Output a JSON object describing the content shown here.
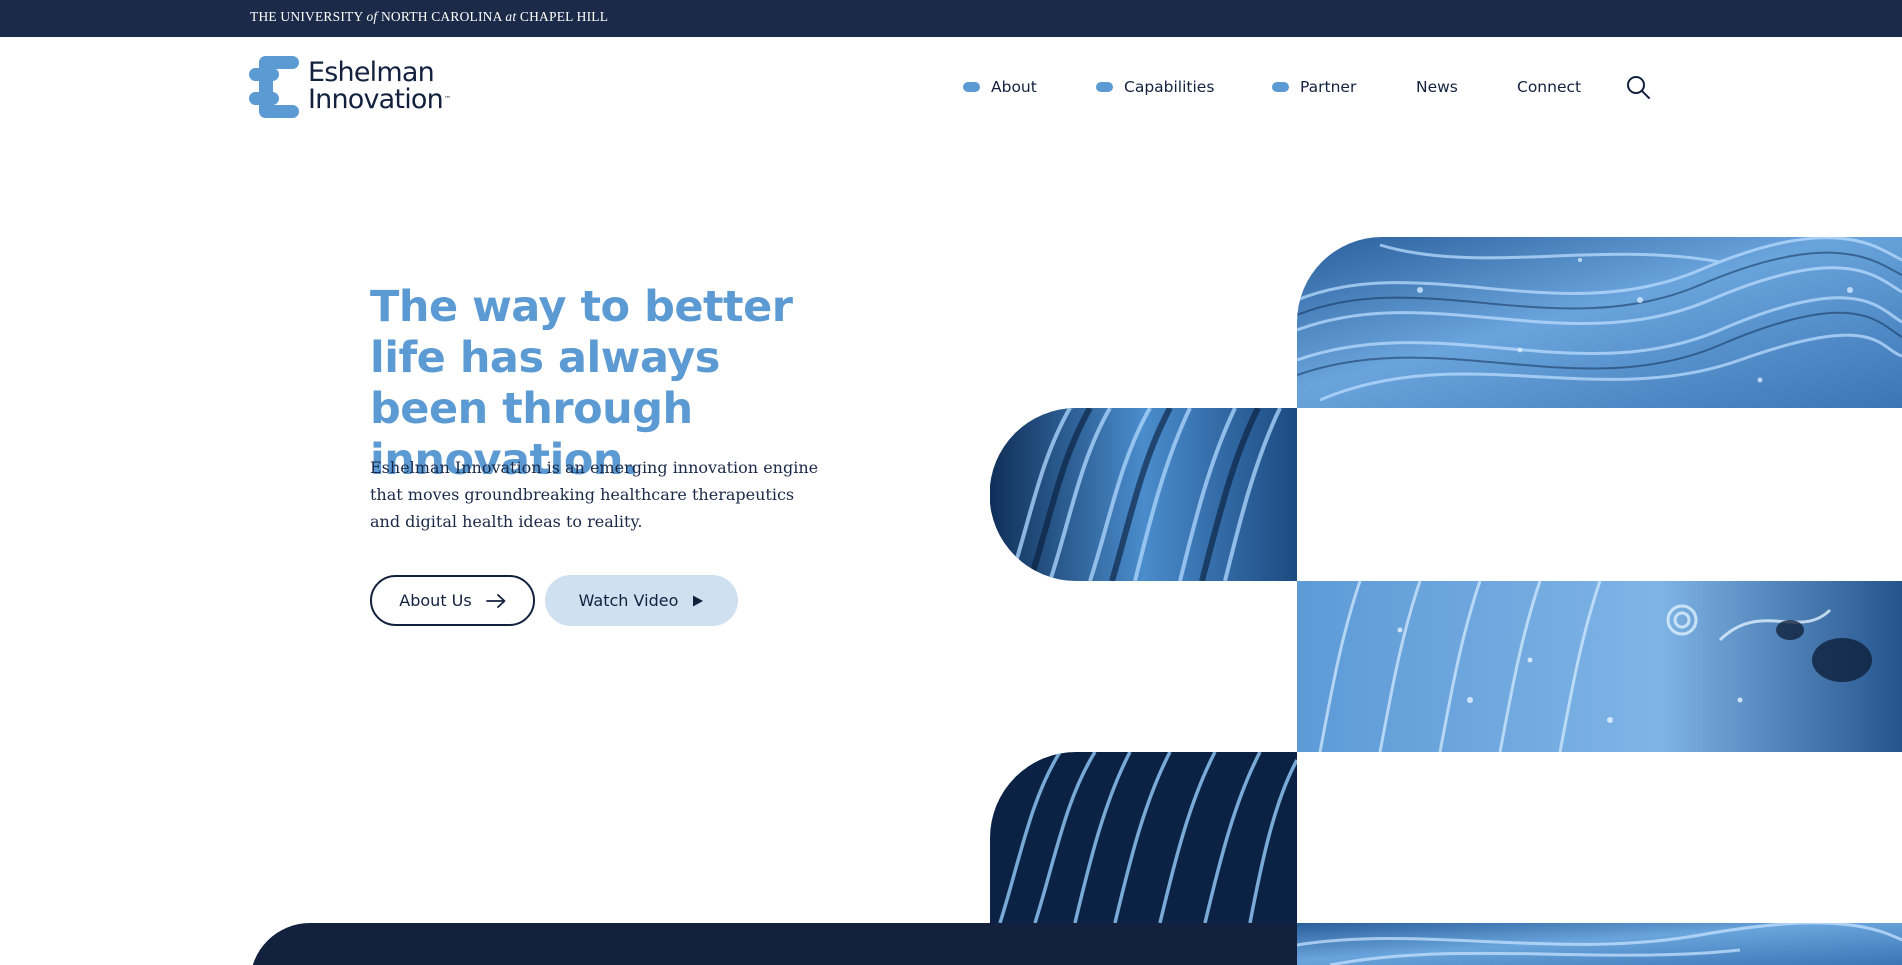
{
  "university_bar": {
    "part1": "THE UNIVERSITY ",
    "part2": "of",
    "part3": " NORTH CAROLINA ",
    "part4": "at",
    "part5": " CHAPEL HILL"
  },
  "logo": {
    "line1": "Eshelman",
    "line2": "Innovation",
    "trademark": "™"
  },
  "nav": {
    "items": [
      {
        "label": "About",
        "has_dropdown": true
      },
      {
        "label": "Capabilities",
        "has_dropdown": true
      },
      {
        "label": "Partner",
        "has_dropdown": true
      },
      {
        "label": "News",
        "has_dropdown": false
      },
      {
        "label": "Connect",
        "has_dropdown": false
      }
    ],
    "search_icon": "search-icon"
  },
  "hero": {
    "title": "The way to better life has always been through innovation.",
    "body": "Eshelman Innovation is an emerging innovation engine that moves groundbreaking healthcare therapeutics and digital health ideas to reality.",
    "buttons": {
      "about_label": "About Us",
      "about_icon": "arrow-right-icon",
      "watch_label": "Watch Video",
      "watch_icon": "play-icon"
    }
  },
  "colors": {
    "navy": "#13213f",
    "top_bar": "#1b2a48",
    "accent_blue": "#5b9ad2",
    "light_blue": "#cfe0f0",
    "white": "#ffffff"
  }
}
